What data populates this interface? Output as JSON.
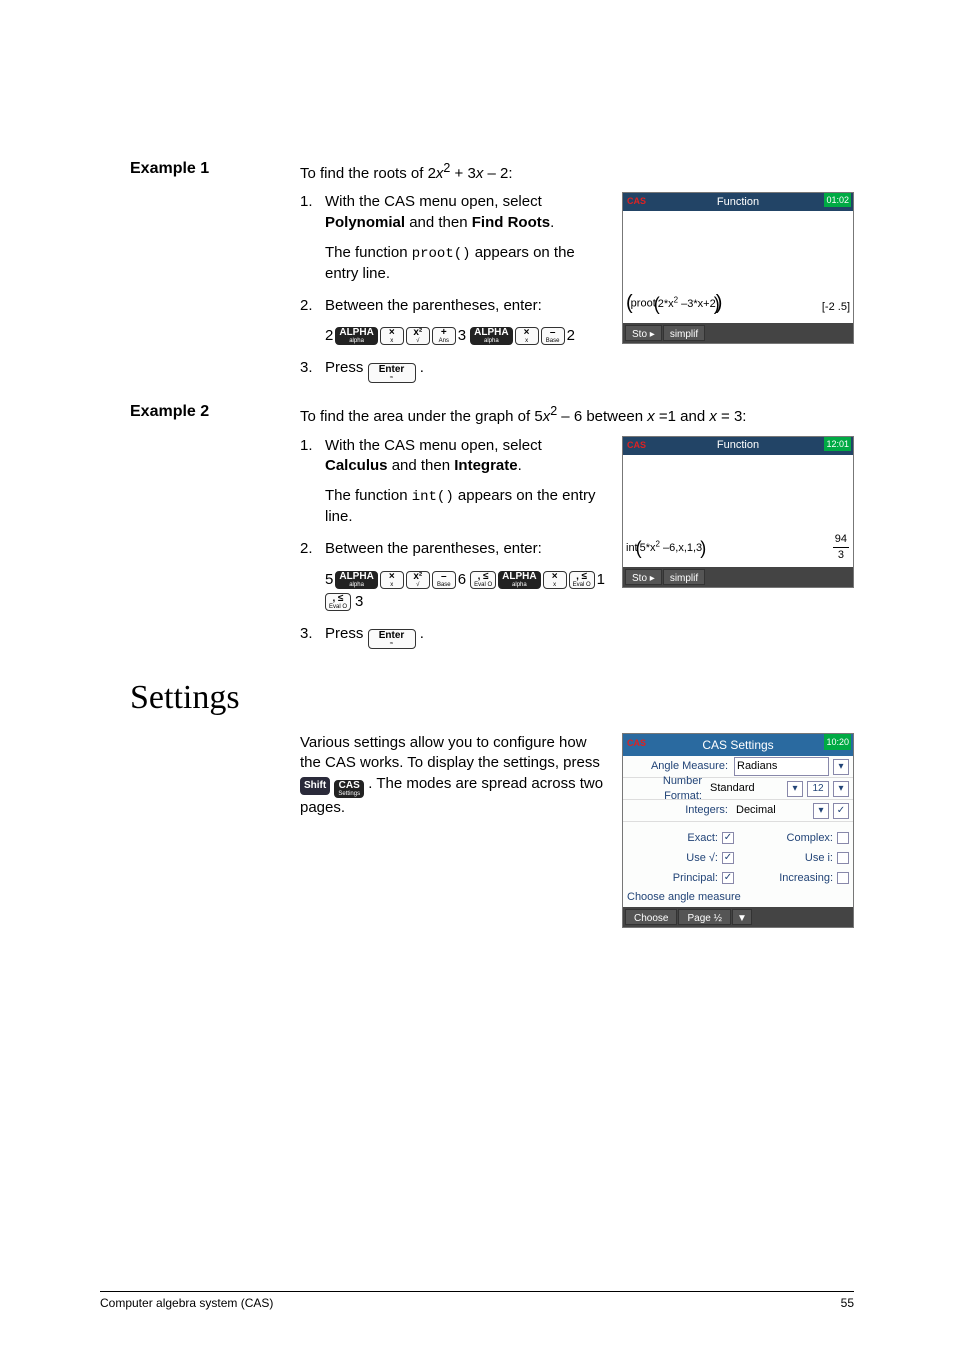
{
  "ex1": {
    "label": "Example 1",
    "lead_a": "To find the roots of 2",
    "lead_x1": "x",
    "lead_b": " + 3",
    "lead_x2": "x",
    "lead_c": " – 2:",
    "step1_a": "With the CAS menu open, select ",
    "step1_b": "Polynomial",
    "step1_c": " and then ",
    "step1_d": "Find Roots",
    "step1_e": ".",
    "func_a": "The function ",
    "func_code": "proot()",
    "func_b": " appears on the entry line.",
    "step2": "Between the parentheses, enter:",
    "seq_pre": "2",
    "seq_mid": "3",
    "seq_end": "2",
    "step3_a": "Press ",
    "step3_b": ".",
    "calc": {
      "title": "Function",
      "time": "01:02",
      "cas": "CAS",
      "expr": "proot 2*x  –3*x+2",
      "sup": "2",
      "result": "[-2 .5]",
      "sto": "Sto ▸",
      "simplif": "simplif"
    }
  },
  "ex2": {
    "label": "Example 2",
    "lead_a": "To find the area under the graph of 5",
    "lead_x1": "x",
    "lead_b": " – 6 between ",
    "lead_xc": "x ",
    "lead_c": "=1 and ",
    "lead_xd": "x",
    "lead_d": " = 3:",
    "step1_a": "With the CAS menu open, select ",
    "step1_b": "Calculus",
    "step1_c": " and then ",
    "step1_d": "Integrate",
    "step1_e": ".",
    "func_a": "The function ",
    "func_code": "int()",
    "func_b": " appears on the entry line.",
    "step2": "Between the parentheses, enter:",
    "seq_pre": "5",
    "seq_mid": "6",
    "seq_mid2": "1",
    "seq_end": "3",
    "step3_a": "Press ",
    "step3_b": ".",
    "calc": {
      "title": "Function",
      "time": "12:01",
      "cas": "CAS",
      "expr": "int 5*x  –6,x,1,3",
      "sup": "2",
      "res_top": "94",
      "res_bot": "3",
      "sto": "Sto ▸",
      "simplif": "simplif"
    }
  },
  "keys": {
    "alpha_main": "ALPHA",
    "alpha_sub": "alpha",
    "x_main": "×",
    "x_sub": "x",
    "xsq_main": "x²",
    "xsq_sub": "√",
    "plus_main": "+",
    "plus_sub": "Ans",
    "minus_main": "–",
    "minus_sub": "Base",
    "comma_main": ", ≤",
    "comma_sub": "Eval    O",
    "enter_main": "Enter",
    "enter_sub": "≈",
    "shift_main": "Shift",
    "cas_main": "CAS",
    "cas_sub": "Settings"
  },
  "settings": {
    "heading": "Settings",
    "body_a": "Various settings allow you to configure how the CAS works. To display the settings, press ",
    "body_b": ". The modes are spread across two pages.",
    "box": {
      "title": "CAS Settings",
      "time": "10:20",
      "cas": "CAS",
      "r1l": "Angle Measure:",
      "r1v": "Radians",
      "r2l": "Number Format:",
      "r2v": "Standard",
      "r2n": "12",
      "r3l": "Integers:",
      "r3v": "Decimal",
      "r3c": "✓",
      "g1l": "Exact:",
      "g1v": "✓",
      "g2l": "Complex:",
      "g2v": "",
      "g3l": "Use √:",
      "g3v": "✓",
      "g4l": "Use i:",
      "g4v": "",
      "g5l": "Principal:",
      "g5v": "✓",
      "g6l": "Increasing:",
      "g6v": "",
      "msg": "Choose angle measure",
      "b1": "Choose",
      "b2": "Page ½",
      "b3": "▼"
    }
  },
  "footer": {
    "left": "Computer algebra system (CAS)",
    "right": "55"
  }
}
